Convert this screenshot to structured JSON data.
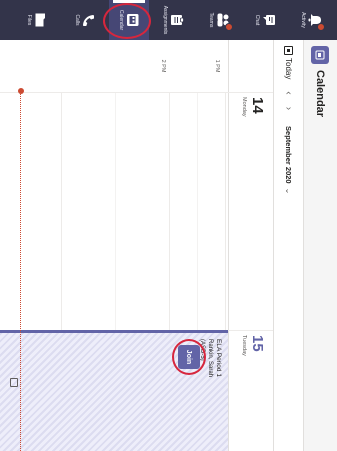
{
  "rail": {
    "items": [
      {
        "label": "Activity",
        "icon": "bell-icon",
        "badge": true
      },
      {
        "label": "Chat",
        "icon": "chat-icon",
        "badge": false
      },
      {
        "label": "Teams",
        "icon": "teams-icon",
        "badge": true
      },
      {
        "label": "Assignments",
        "icon": "assignments-icon",
        "badge": false
      },
      {
        "label": "Calendar",
        "icon": "calendar-icon",
        "badge": false,
        "active": true
      },
      {
        "label": "Calls",
        "icon": "phone-icon",
        "badge": false
      },
      {
        "label": "Files",
        "icon": "files-icon",
        "badge": false
      }
    ]
  },
  "calendar": {
    "title": "Calendar",
    "today_label": "Today",
    "month_label": "September 2020",
    "days": [
      {
        "number": "14",
        "name": "Monday"
      },
      {
        "number": "15",
        "name": "Tuesday"
      }
    ],
    "times": [
      "1 PM",
      "2 PM"
    ],
    "event": {
      "title": "ELA Period 1",
      "organizer": "Rankin, Sarah",
      "code": "(ASD-5)",
      "join_label": "Join"
    }
  },
  "colors": {
    "rail_bg": "#33344a",
    "accent": "#6264a7",
    "badge": "#cc4a31",
    "highlight_ring": "#d7263d"
  }
}
